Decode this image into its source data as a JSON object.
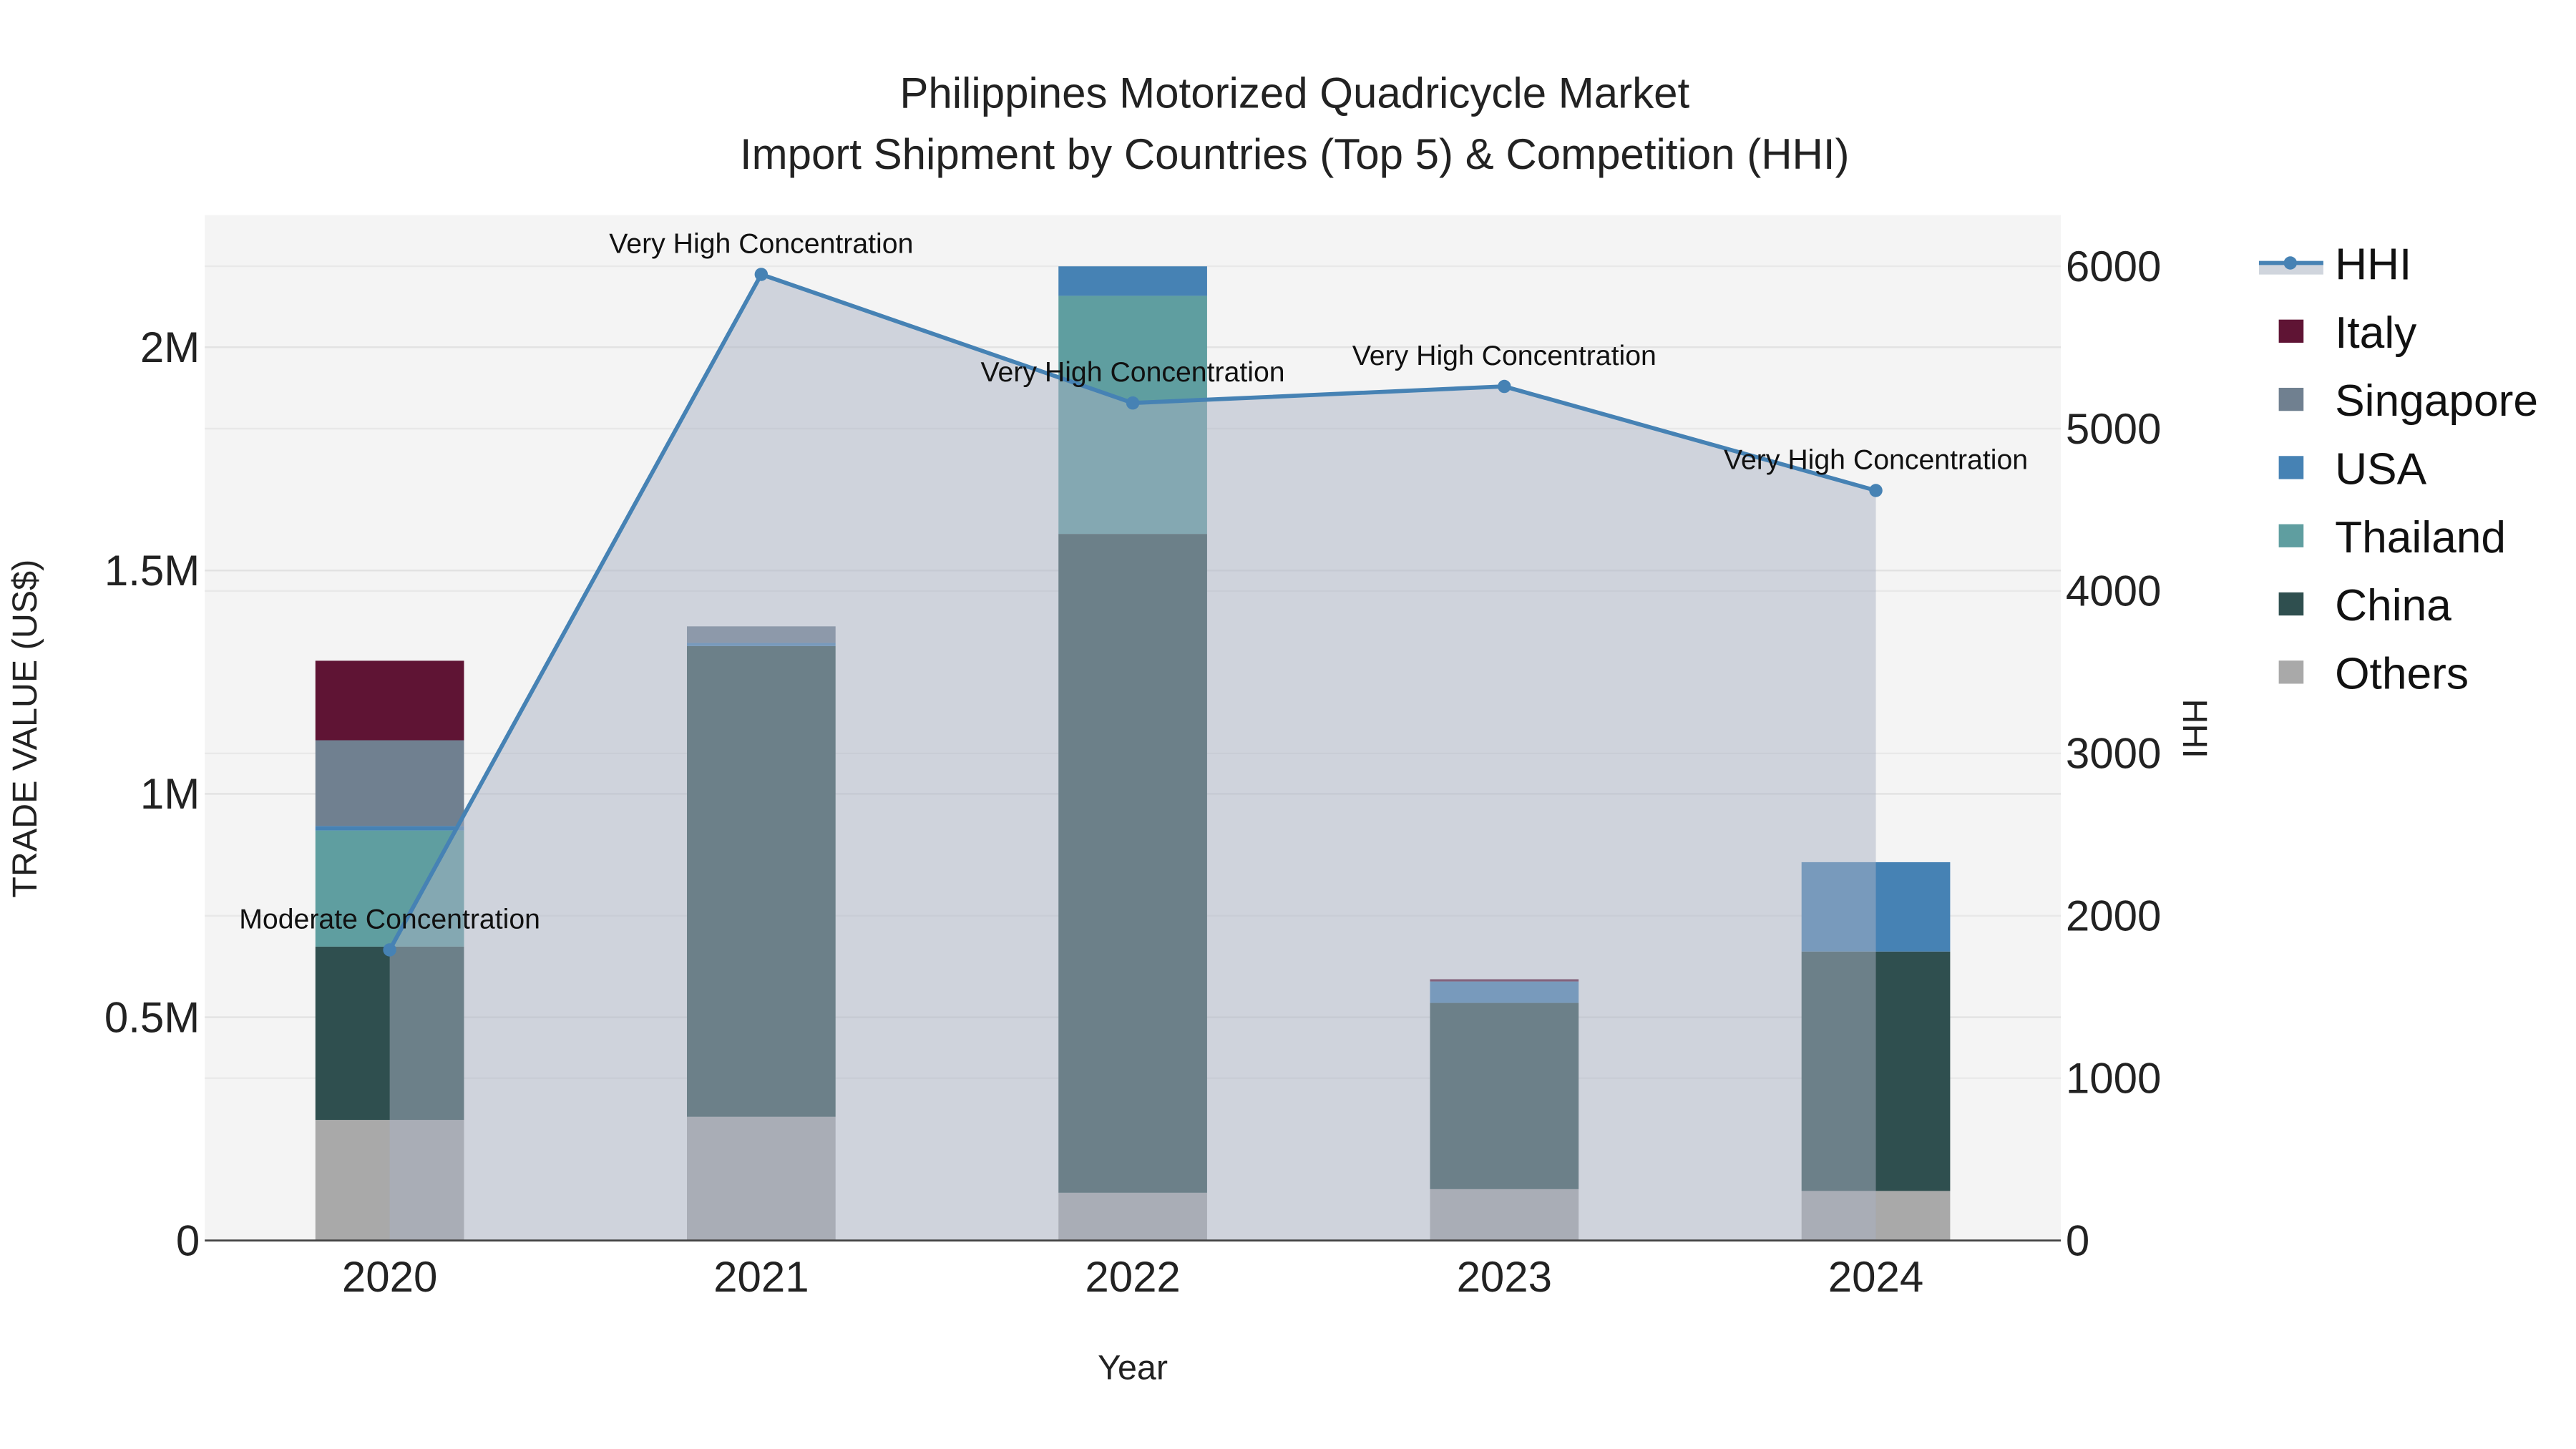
{
  "chart_data": {
    "type": "bar",
    "title_line1": "Philippines Motorized Quadricycle Market",
    "title_line2": "Import Shipment by Countries (Top 5) & Competition (HHI)",
    "xlabel": "Year",
    "ylabel": "TRADE VALUE (US$)",
    "y2label": "HHI",
    "categories": [
      "2020",
      "2021",
      "2022",
      "2023",
      "2024"
    ],
    "ylim": [
      0,
      2300000
    ],
    "yticks": [
      0,
      500000,
      1000000,
      1500000,
      2000000
    ],
    "ytick_labels": [
      "0",
      "0.5M",
      "1M",
      "1.5M",
      "2M"
    ],
    "y2lim": [
      0,
      6300
    ],
    "y2ticks": [
      0,
      1000,
      2000,
      3000,
      4000,
      5000,
      6000
    ],
    "y2tick_labels": [
      "0",
      "1000",
      "2000",
      "3000",
      "4000",
      "5000",
      "6000"
    ],
    "grid": true,
    "legend_position": "right",
    "series": [
      {
        "name": "Others",
        "color": "#a9a9a9",
        "values": [
          270000,
          277000,
          107000,
          115000,
          111000
        ]
      },
      {
        "name": "China",
        "color": "#2f4f4f",
        "values": [
          388000,
          1054000,
          1475000,
          417000,
          536000
        ]
      },
      {
        "name": "Thailand",
        "color": "#5f9ea0",
        "values": [
          260000,
          0,
          533000,
          0,
          0
        ]
      },
      {
        "name": "USA",
        "color": "#4682b4",
        "values": [
          10000,
          7000,
          66000,
          48000,
          200000
        ]
      },
      {
        "name": "Singapore",
        "color": "#708090",
        "values": [
          192000,
          37000,
          0,
          0,
          0
        ]
      },
      {
        "name": "Italy",
        "color": "#5f1434",
        "values": [
          178000,
          0,
          0,
          5000,
          0
        ]
      }
    ],
    "legend_order": [
      "HHI",
      "Italy",
      "Singapore",
      "USA",
      "Thailand",
      "China",
      "Others"
    ],
    "hhi": {
      "name": "HHI",
      "color": "#4682b4",
      "values": [
        1790,
        5950,
        5158,
        5260,
        4619
      ],
      "annotations": [
        "Moderate Concentration",
        "Very High Concentration",
        "Very High Concentration",
        "Very High Concentration",
        "Very High Concentration"
      ]
    }
  }
}
